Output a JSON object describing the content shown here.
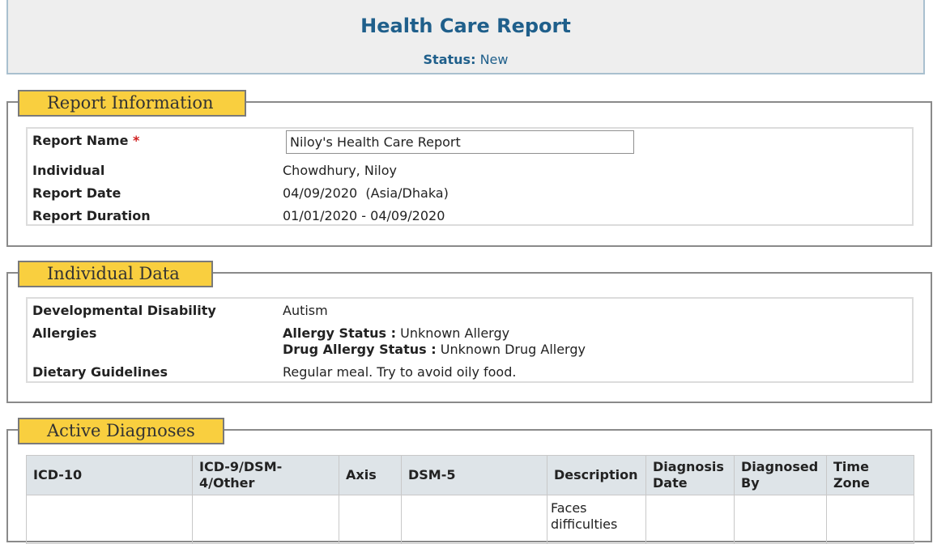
{
  "header": {
    "title": "Health Care Report",
    "status_label": "Status:",
    "status_value": "New"
  },
  "report_information": {
    "legend": "Report Information",
    "report_name_label": "Report Name",
    "required_mark": "*",
    "report_name_value": "Niloy's Health Care Report",
    "individual_label": "Individual",
    "individual_value": "Chowdhury, Niloy",
    "report_date_label": "Report Date",
    "report_date_value": "04/09/2020  (Asia/Dhaka)",
    "report_duration_label": "Report Duration",
    "report_duration_value": "01/01/2020 - 04/09/2020"
  },
  "individual_data": {
    "legend": "Individual Data",
    "dev_disability_label": "Developmental Disability",
    "dev_disability_value": "Autism",
    "allergies_label": "Allergies",
    "allergy_status_label": "Allergy Status :",
    "allergy_status_value": "Unknown Allergy",
    "drug_allergy_status_label": "Drug Allergy Status :",
    "drug_allergy_status_value": "Unknown Drug Allergy",
    "dietary_label": "Dietary Guidelines",
    "dietary_value": "Regular meal. Try to avoid oily food."
  },
  "active_diagnoses": {
    "legend": "Active Diagnoses",
    "columns": [
      "ICD-10",
      "ICD-9/DSM-4/Other",
      "Axis",
      "DSM-5",
      "Description",
      "Diagnosis Date",
      "Diagnosed By",
      "Time Zone"
    ],
    "rows": [
      {
        "icd10": "",
        "icd9": "",
        "axis": "",
        "dsm5": "",
        "description": "Faces difficulties",
        "diagnosis_date": "",
        "diagnosed_by": "",
        "time_zone": ""
      }
    ]
  }
}
